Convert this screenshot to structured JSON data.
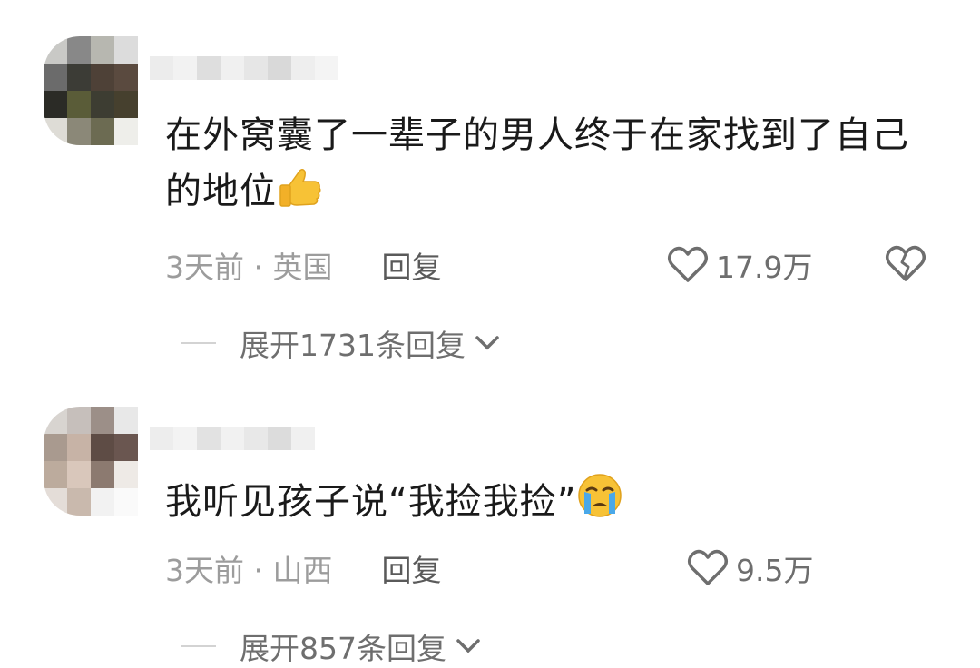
{
  "comments": [
    {
      "text": "在外窝囊了一辈子的男人终于在家找到了自己的地位",
      "emoji": "thumbs-up",
      "meta": "3天前 · 英国",
      "reply_label": "回复",
      "likes": "17.9万",
      "expand_label": "展开1731条回复"
    },
    {
      "text": "我听见孩子说“我捡我捡”",
      "emoji": "loudly-crying-face",
      "meta": "3天前 · 山西",
      "reply_label": "回复",
      "likes": "9.5万",
      "expand_label": "展开857条回复"
    }
  ],
  "colors": {
    "text": "#1a1a1a",
    "meta": "#9c9c9c",
    "icon": "#6e6e6e",
    "emoji_yellow": "#f7c236"
  }
}
